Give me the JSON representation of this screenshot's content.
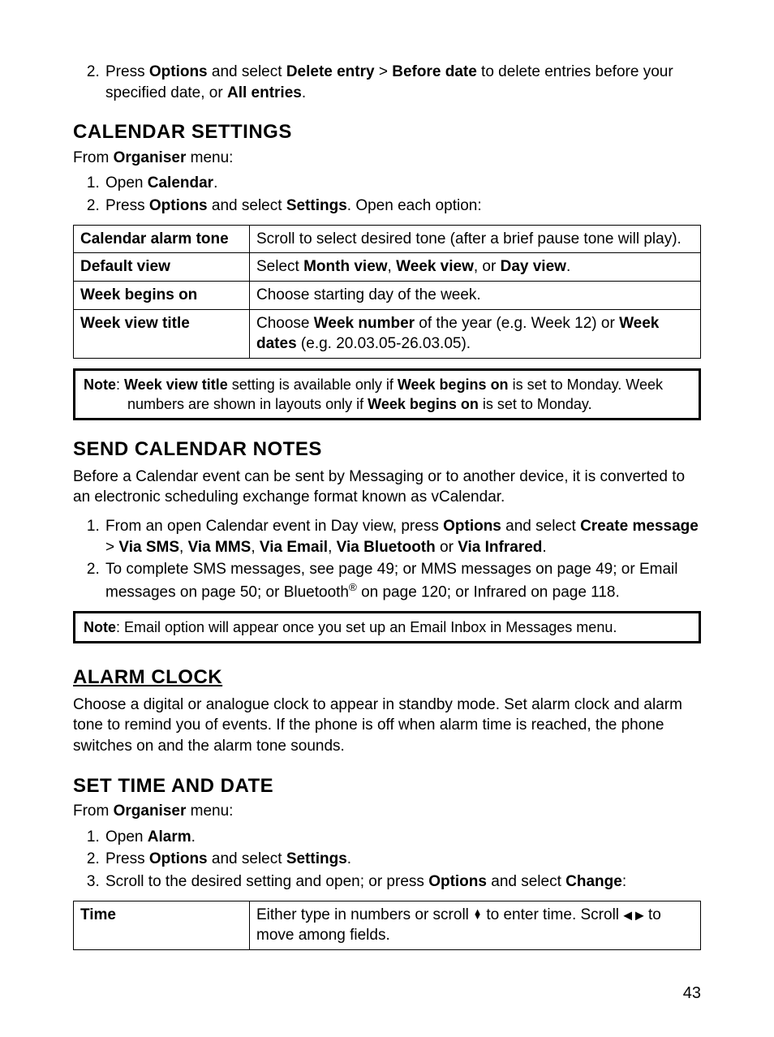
{
  "step2top": {
    "num": "2.",
    "a": "Press ",
    "b": "Options",
    "c": " and select ",
    "d": "Delete entry",
    "e": " > ",
    "f": "Before date",
    "g": " to delete entries before your specified date, or ",
    "h": "All entries",
    "i": "."
  },
  "calset": {
    "heading": "CALENDAR SETTINGS",
    "intro_a": "From ",
    "intro_b": "Organiser",
    "intro_c": " menu:",
    "s1": {
      "num": "1.",
      "a": "Open ",
      "b": "Calendar",
      "c": "."
    },
    "s2": {
      "num": "2.",
      "a": "Press ",
      "b": "Options",
      "c": " and select ",
      "d": "Settings",
      "e": ". Open each option:"
    },
    "table": {
      "r1": {
        "label": "Calendar alarm tone",
        "val": "Scroll to select desired tone (after a brief pause tone will play)."
      },
      "r2": {
        "label": "Default view",
        "a": "Select ",
        "b": "Month view",
        "c": ", ",
        "d": "Week view",
        "e": ", or ",
        "f": "Day view",
        "g": "."
      },
      "r3": {
        "label": "Week begins on",
        "val": "Choose starting day of the week."
      },
      "r4": {
        "label": "Week view title",
        "a": "Choose ",
        "b": "Week number",
        "c": " of the year (e.g. Week 12) or ",
        "d": "Week dates",
        "e": " (e.g. 20.03.05-26.03.05)."
      }
    },
    "note": {
      "prefix": "Note",
      "a": ":  ",
      "b": "Week view title",
      "c": " setting is available only if ",
      "d": "Week begins on",
      "e": " is set to Monday. Week numbers are shown in layouts only if ",
      "f": "Week begins on",
      "g": " is set to Monday."
    }
  },
  "send": {
    "heading": "SEND CALENDAR NOTES",
    "body": "Before a Calendar event can be sent by Messaging or to another device, it is converted to an electronic scheduling exchange format known as vCalendar.",
    "s1": {
      "num": "1.",
      "a": "From an open Calendar event in Day view, press ",
      "b": "Options",
      "c": " and select ",
      "d": "Create message",
      "e": " > ",
      "f": "Via SMS",
      "g": ", ",
      "h": "Via MMS",
      "i": ", ",
      "j": "Via Email",
      "k": ", ",
      "l": "Via Bluetooth",
      "m": " or ",
      "n": "Via Infrared",
      "o": "."
    },
    "s2": {
      "num": "2.",
      "a": "To complete SMS messages, see page 49; or MMS messages on page 49; or Email messages on page 50; or  Bluetooth",
      "b": " on page 120; or Infrared on page 118."
    },
    "note": {
      "prefix": "Note",
      "text": ":  Email option will appear once you set up an Email Inbox in Messages menu."
    }
  },
  "alarm": {
    "heading": "ALARM CLOCK",
    "body": "Choose a digital or analogue clock to appear in standby mode. Set alarm clock and alarm tone to remind you of events. If the phone is off when alarm time is reached, the phone switches on and the alarm tone sounds."
  },
  "settime": {
    "heading": "SET TIME AND DATE",
    "intro_a": "From ",
    "intro_b": "Organiser",
    "intro_c": " menu:",
    "s1": {
      "num": "1.",
      "a": "Open ",
      "b": "Alarm",
      "c": "."
    },
    "s2": {
      "num": "2.",
      "a": "Press ",
      "b": "Options",
      "c": " and select ",
      "d": "Settings",
      "e": "."
    },
    "s3": {
      "num": "3.",
      "a": "Scroll to the desired setting and open; or press ",
      "b": "Options",
      "c": " and select ",
      "d": "Change",
      "e": ":"
    },
    "table": {
      "r1": {
        "label": "Time",
        "a": "Either type in numbers or scroll ",
        "b": " to enter time. Scroll ",
        "c": " to move among fields."
      }
    }
  },
  "pagenum": "43",
  "icons": {
    "updown": "▲▼",
    "leftright": "◀ ▶"
  }
}
